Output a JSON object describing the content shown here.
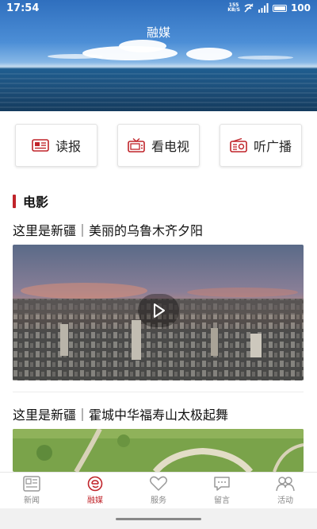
{
  "status_bar": {
    "time": "17:54",
    "network_speed_top": "155",
    "network_speed_unit": "KB/S",
    "battery": "100"
  },
  "header": {
    "title": "融媒"
  },
  "quick_actions": [
    {
      "label": "读报",
      "icon": "newspaper-icon"
    },
    {
      "label": "看电视",
      "icon": "tv-icon"
    },
    {
      "label": "听广播",
      "icon": "radio-icon"
    }
  ],
  "section": {
    "title": "电影"
  },
  "articles": [
    {
      "title": "这里是新疆｜美丽的乌鲁木齐夕阳",
      "has_video": true
    },
    {
      "title": "这里是新疆｜霍城中华福寿山太极起舞",
      "has_video": false
    }
  ],
  "bottom_nav": [
    {
      "label": "新闻",
      "icon": "news-icon",
      "active": false
    },
    {
      "label": "融媒",
      "icon": "media-icon",
      "active": true
    },
    {
      "label": "服务",
      "icon": "heart-icon",
      "active": false
    },
    {
      "label": "留言",
      "icon": "message-icon",
      "active": false
    },
    {
      "label": "活动",
      "icon": "people-icon",
      "active": false
    }
  ],
  "colors": {
    "accent": "#c0242a",
    "inactive": "#888888"
  }
}
